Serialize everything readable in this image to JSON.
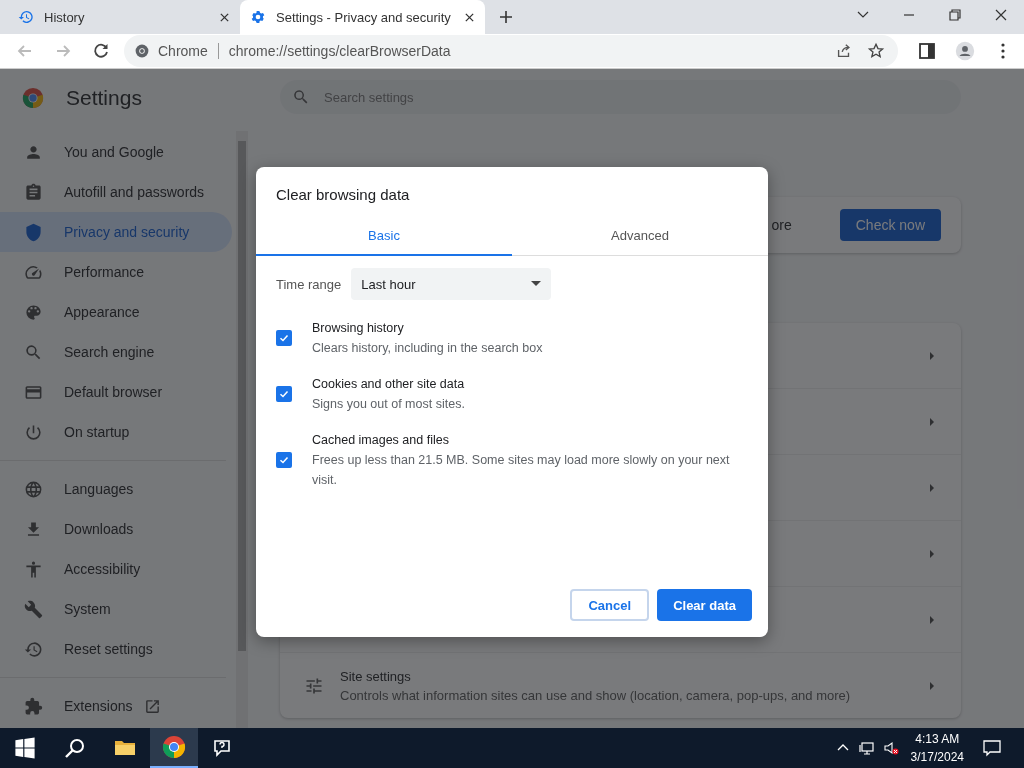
{
  "browser_tabs": [
    {
      "kind": "history",
      "title": "History",
      "selected": false
    },
    {
      "kind": "settings",
      "title": "Settings - Privacy and security",
      "selected": true
    }
  ],
  "address_bar": {
    "site_label": "Chrome",
    "url": "chrome://settings/clearBrowserData"
  },
  "settings": {
    "title": "Settings",
    "search": {
      "placeholder": "Search settings"
    },
    "nav_groups": [
      [
        {
          "kind": "person",
          "label": "You and Google",
          "selected": false
        },
        {
          "kind": "clipboard",
          "label": "Autofill and passwords",
          "selected": false
        },
        {
          "kind": "shield",
          "label": "Privacy and security",
          "selected": true
        },
        {
          "kind": "gauge",
          "label": "Performance",
          "selected": false
        },
        {
          "kind": "palette",
          "label": "Appearance",
          "selected": false
        },
        {
          "kind": "search",
          "label": "Search engine",
          "selected": false
        },
        {
          "kind": "browser",
          "label": "Default browser",
          "selected": false
        },
        {
          "kind": "power",
          "label": "On startup",
          "selected": false
        }
      ],
      [
        {
          "kind": "globe",
          "label": "Languages",
          "selected": false
        },
        {
          "kind": "download",
          "label": "Downloads",
          "selected": false
        },
        {
          "kind": "accessibility",
          "label": "Accessibility",
          "selected": false
        },
        {
          "kind": "wrench",
          "label": "System",
          "selected": false
        },
        {
          "kind": "history",
          "label": "Reset settings",
          "selected": false
        }
      ],
      [
        {
          "kind": "puzzle",
          "label": "Extensions",
          "selected": false,
          "external": true
        }
      ]
    ],
    "safety_card": {
      "text": "ore",
      "button": "Check now"
    },
    "site_settings": {
      "title": "Site settings",
      "description": "Controls what information sites can use and show (location, camera, pop-ups, and more)"
    }
  },
  "dialog": {
    "title": "Clear browsing data",
    "tabs": [
      {
        "label": "Basic",
        "selected": true
      },
      {
        "label": "Advanced",
        "selected": false
      }
    ],
    "time_range": {
      "label": "Time range",
      "value": "Last hour"
    },
    "options": [
      {
        "title": "Browsing history",
        "description": "Clears history, including in the search box",
        "checked": true
      },
      {
        "title": "Cookies and other site data",
        "description": "Signs you out of most sites.",
        "checked": true
      },
      {
        "title": "Cached images and files",
        "description": "Frees up less than 21.5 MB. Some sites may load more slowly on your next visit.",
        "checked": true
      }
    ],
    "buttons": [
      {
        "label": "Cancel",
        "kind": "secondary"
      },
      {
        "label": "Clear data",
        "kind": "primary"
      }
    ]
  },
  "taskbar": {
    "time": "4:13 AM",
    "date": "3/17/2024"
  }
}
